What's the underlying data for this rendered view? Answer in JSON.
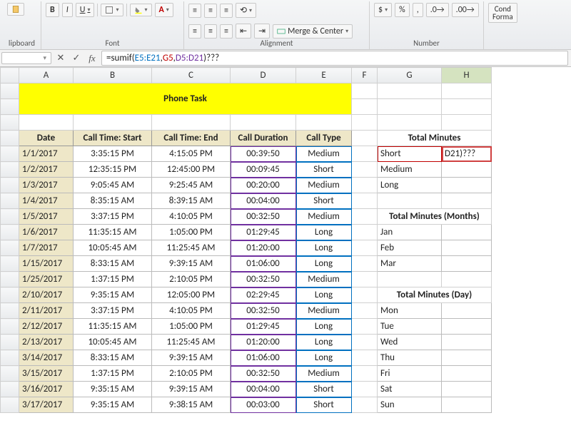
{
  "ribbon": {
    "clipboard_label": "lipboard",
    "font_label": "Font",
    "alignment_label": "Alignment",
    "number_label": "Number",
    "bold": "B",
    "italic": "I",
    "underline": "U",
    "font_color": "A",
    "merge_center": "Merge & Center",
    "percent": "%",
    "comma": ",",
    "cond_fmt": "Cond\nForma"
  },
  "formula_bar": {
    "namebox": "",
    "fx": "fx",
    "formula_prefix": "=sumif(",
    "ref1": "E5:E21",
    "ref2": "G5",
    "ref3": "D5:D21",
    "formula_suffix": ")???"
  },
  "columns": [
    "A",
    "B",
    "C",
    "D",
    "E",
    "F",
    "G",
    "H"
  ],
  "title": "Phone Task",
  "headers": {
    "date": "Date",
    "start": "Call Time: Start",
    "end": "Call Time: End",
    "duration": "Call Duration",
    "type": "Call Type"
  },
  "sections": {
    "total_minutes": "Total Minutes",
    "total_months": "Total Minutes (Months)",
    "total_day": "Total Minutes (Day)"
  },
  "rows": [
    {
      "date": "1/1/2017",
      "start": "3:35:15 PM",
      "end": "4:15:05 PM",
      "dur": "00:39:50",
      "type": "Medium"
    },
    {
      "date": "1/2/2017",
      "start": "12:35:15 PM",
      "end": "12:45:00 PM",
      "dur": "00:09:45",
      "type": "Short"
    },
    {
      "date": "1/3/2017",
      "start": "9:05:45 AM",
      "end": "9:25:45 AM",
      "dur": "00:20:00",
      "type": "Medium"
    },
    {
      "date": "1/4/2017",
      "start": "8:35:15 AM",
      "end": "8:39:15 AM",
      "dur": "00:04:00",
      "type": "Short"
    },
    {
      "date": "1/5/2017",
      "start": "3:37:15 PM",
      "end": "4:10:05 PM",
      "dur": "00:32:50",
      "type": "Medium"
    },
    {
      "date": "1/6/2017",
      "start": "11:35:15 AM",
      "end": "1:05:00 PM",
      "dur": "01:29:45",
      "type": "Long"
    },
    {
      "date": "1/7/2017",
      "start": "10:05:45 AM",
      "end": "11:25:45 AM",
      "dur": "01:20:00",
      "type": "Long"
    },
    {
      "date": "1/15/2017",
      "start": "8:33:15 AM",
      "end": "9:39:15 AM",
      "dur": "01:06:00",
      "type": "Long"
    },
    {
      "date": "1/25/2017",
      "start": "1:37:15 PM",
      "end": "2:10:05 PM",
      "dur": "00:32:50",
      "type": "Medium"
    },
    {
      "date": "2/10/2017",
      "start": "9:35:15 AM",
      "end": "12:05:00 PM",
      "dur": "02:29:45",
      "type": "Long"
    },
    {
      "date": "2/11/2017",
      "start": "3:37:15 PM",
      "end": "4:10:05 PM",
      "dur": "00:32:50",
      "type": "Medium"
    },
    {
      "date": "2/12/2017",
      "start": "11:35:15 AM",
      "end": "1:05:00 PM",
      "dur": "01:29:45",
      "type": "Long"
    },
    {
      "date": "2/13/2017",
      "start": "10:05:45 AM",
      "end": "11:25:45 AM",
      "dur": "01:20:00",
      "type": "Long"
    },
    {
      "date": "3/14/2017",
      "start": "8:33:15 AM",
      "end": "9:39:15 AM",
      "dur": "01:06:00",
      "type": "Long"
    },
    {
      "date": "3/15/2017",
      "start": "1:37:15 PM",
      "end": "2:10:05 PM",
      "dur": "00:32:50",
      "type": "Medium"
    },
    {
      "date": "3/16/2017",
      "start": "9:35:15 AM",
      "end": "9:39:15 AM",
      "dur": "00:04:00",
      "type": "Short"
    },
    {
      "date": "3/17/2017",
      "start": "9:35:15 AM",
      "end": "9:38:15 AM",
      "dur": "00:03:00",
      "type": "Short"
    }
  ],
  "total_minutes_rows": [
    {
      "label": "Short",
      "value": "D21)???"
    },
    {
      "label": "Medium",
      "value": ""
    },
    {
      "label": "Long",
      "value": ""
    }
  ],
  "months": [
    "Jan",
    "Feb",
    "Mar"
  ],
  "days": [
    "Mon",
    "Tue",
    "Wed",
    "Thu",
    "Fri",
    "Sat",
    "Sun"
  ]
}
